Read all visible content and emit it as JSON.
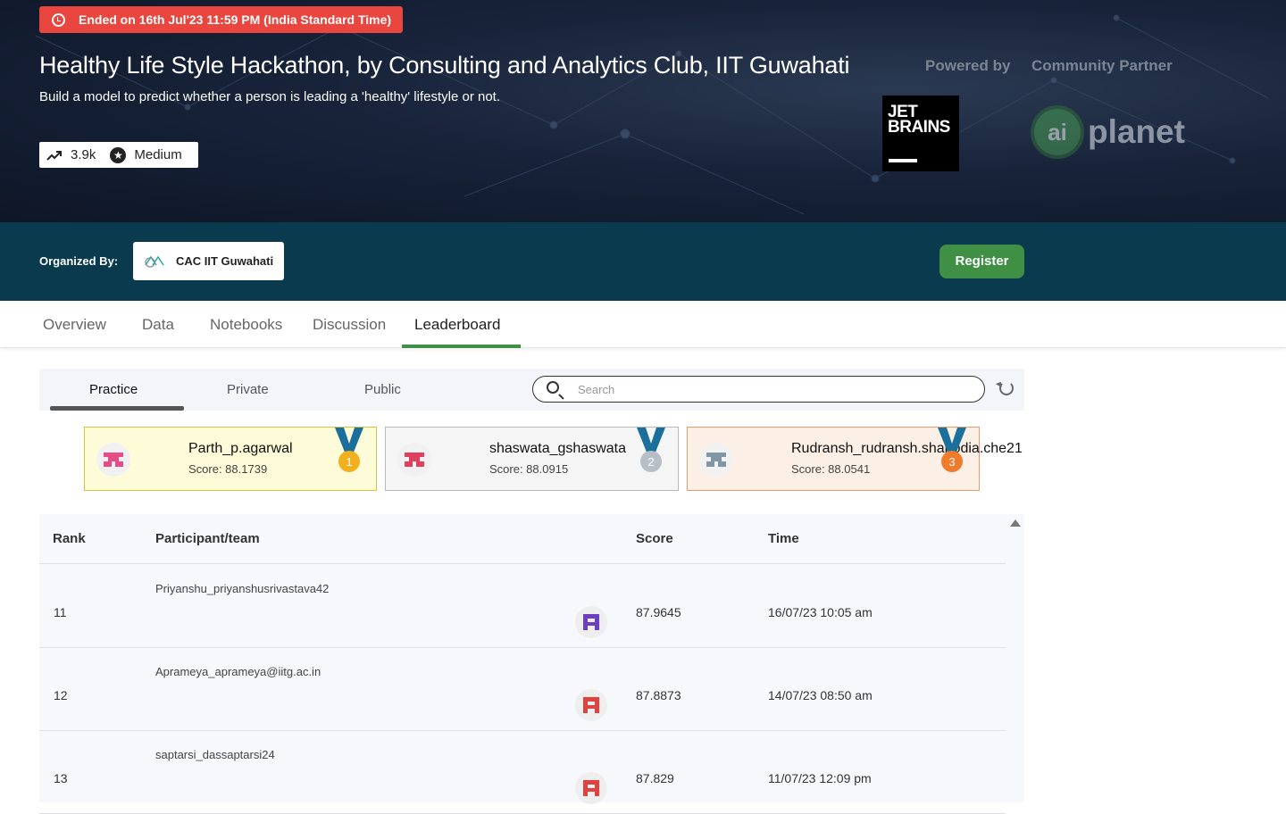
{
  "hero": {
    "status": "Ended on 16th Jul'23 11:59 PM (India Standard Time)",
    "title": "Healthy Life Style Hackathon, by Consulting and Analytics Club, IIT Guwahati",
    "subtitle": "Build a model to predict whether a person is leading a 'healthy' lifestyle or not.",
    "views": "3.9k",
    "difficulty": "Medium",
    "powered_by_label": "Powered by",
    "community_partner_label": "Community Partner",
    "sponsor_logo_text": "JET BRAINS",
    "partner_logo_text": "planet",
    "partner_logo_mark": "ai"
  },
  "organizer": {
    "label": "Organized By:",
    "name": "CAC IIT Guwahati",
    "register_label": "Register"
  },
  "tabs": [
    "Overview",
    "Data",
    "Notebooks",
    "Discussion",
    "Leaderboard"
  ],
  "active_tab": "Leaderboard",
  "leaderboard": {
    "subtabs": [
      "Practice",
      "Private",
      "Public"
    ],
    "active_subtab": "Practice",
    "search_placeholder": "Search",
    "top3": [
      {
        "rank": "1",
        "name": "Parth_p.agarwal",
        "score": "Score: 88.1739",
        "bg": "#fefbd8",
        "border": "#d6c245",
        "medal": "#f2b01e",
        "avatar": "#e84c86"
      },
      {
        "rank": "2",
        "name": "shaswata_gshaswata",
        "score": "Score: 88.0915",
        "bg": "#f5f5f5",
        "border": "#b8b8b8",
        "medal": "#b7bec6",
        "avatar": "#e0405e"
      },
      {
        "rank": "3",
        "name": "Rudransh_rudransh.shahodia.che21",
        "score": "Score: 88.0541",
        "bg": "#fbefe6",
        "border": "#e59b6b",
        "medal": "#f07b2b",
        "avatar": "#7f96a4"
      }
    ],
    "columns": {
      "rank": "Rank",
      "participant": "Participant/team",
      "score": "Score",
      "time": "Time"
    },
    "rows": [
      {
        "rank": "11",
        "participant": "Priyanshu_priyanshusrivastava42",
        "score": "87.9645",
        "time": "16/07/23 10:05 am",
        "avatar": "#6c3fc2"
      },
      {
        "rank": "12",
        "participant": "Aprameya_aprameya@iitg.ac.in",
        "score": "87.8873",
        "time": "14/07/23 08:50 am",
        "avatar": "#e0433f"
      },
      {
        "rank": "13",
        "participant": "saptarsi_dassaptarsi24",
        "score": "87.829",
        "time": "11/07/23 12:09 pm",
        "avatar": "#e0433f"
      }
    ]
  },
  "colors": {
    "accent": "#3f8f45",
    "status": "#e9463f",
    "orgbar": "#0a3a4d",
    "medal_ribbon": "#1a6f9c"
  }
}
